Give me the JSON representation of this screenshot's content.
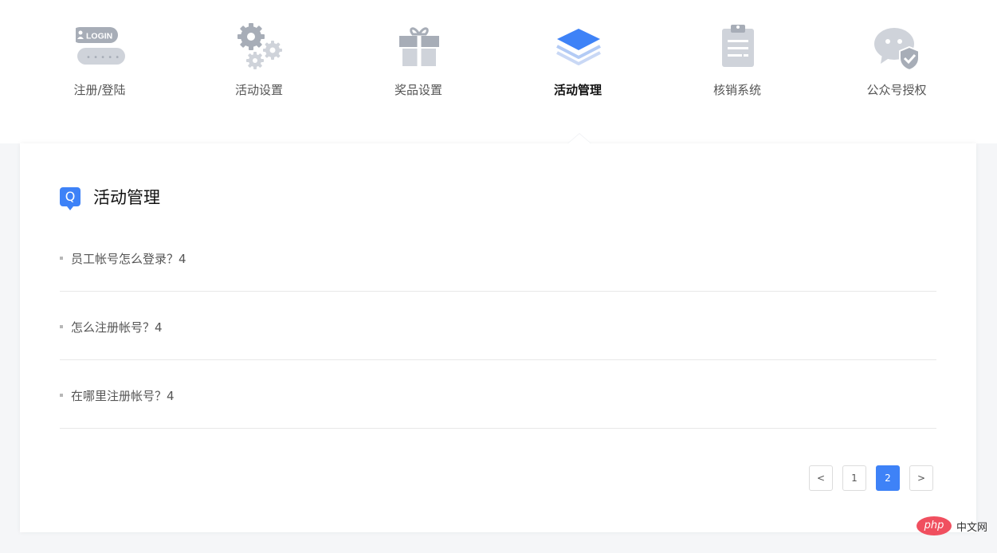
{
  "nav": {
    "items": [
      {
        "label": "注册/登陆",
        "icon": "login-icon"
      },
      {
        "label": "活动设置",
        "icon": "gears-icon"
      },
      {
        "label": "奖品设置",
        "icon": "gift-icon"
      },
      {
        "label": "活动管理",
        "icon": "layers-icon"
      },
      {
        "label": "核销系统",
        "icon": "clipboard-icon"
      },
      {
        "label": "公众号授权",
        "icon": "wechat-shield-icon"
      }
    ],
    "active_index": 3,
    "login_badge": "LOGIN",
    "login_dots": "• • • • •"
  },
  "section": {
    "badge": "Q",
    "title": "活动管理"
  },
  "faqs": [
    {
      "text": "员工帐号怎么登录？4"
    },
    {
      "text": "怎么注册帐号？4"
    },
    {
      "text": "在哪里注册帐号？4"
    }
  ],
  "pager": {
    "prev": "<",
    "pages": [
      "1",
      "2"
    ],
    "current": "2",
    "next": ">"
  },
  "watermark": {
    "brand": "php",
    "text": "中文网"
  },
  "colors": {
    "accent": "#3e82f7",
    "icon_gray": "#a7adb7",
    "icon_light": "#cfd3da"
  }
}
